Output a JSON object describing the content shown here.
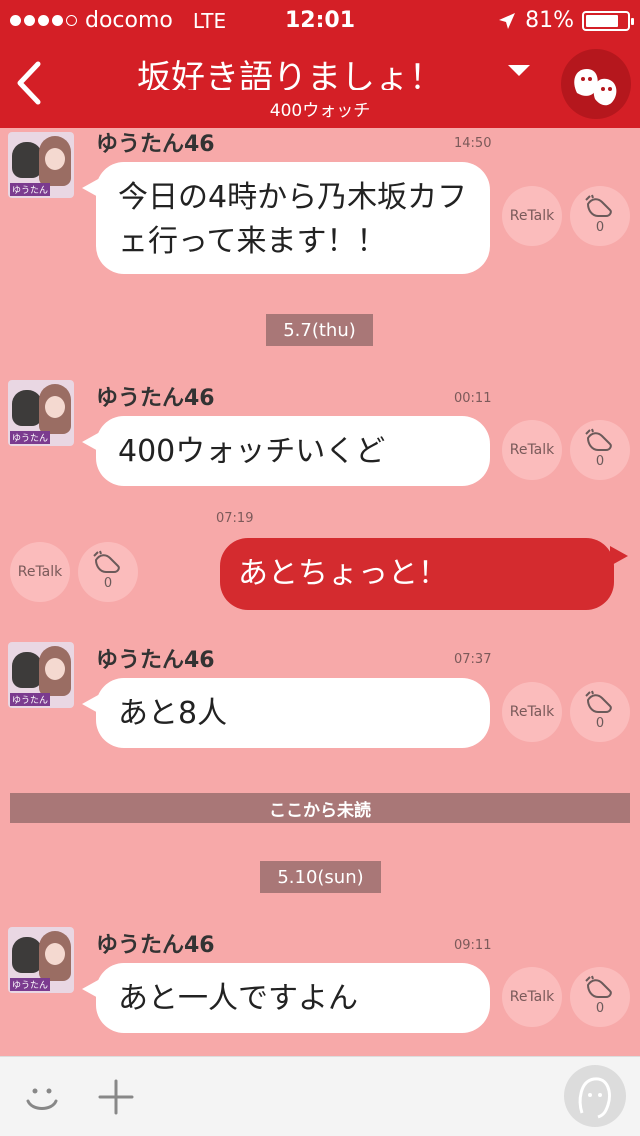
{
  "status_bar": {
    "carrier": "docomo",
    "network": "LTE",
    "time": "12:01",
    "battery": "81%",
    "battery_level": 0.81
  },
  "header": {
    "title": "坂好き語りましょ！",
    "subtitle": "400ウォッチ"
  },
  "messages": [
    {
      "sender": "ゆうたん46",
      "time": "14:50",
      "text": "今日の4時から乃木坂カフェ行って来ます！！",
      "retalk": "ReTalk",
      "claps": "0"
    },
    {
      "date_label": "5.7(thu)"
    },
    {
      "sender": "ゆうたん46",
      "time": "00:11",
      "text": "400ウォッチいくど",
      "retalk": "ReTalk",
      "claps": "0"
    },
    {
      "mine": true,
      "time": "07:19",
      "text": "あとちょっと！",
      "retalk": "ReTalk",
      "claps": "0"
    },
    {
      "sender": "ゆうたん46",
      "time": "07:37",
      "text": "あと8人",
      "retalk": "ReTalk",
      "claps": "0"
    },
    {
      "unread_label": "ここから未読"
    },
    {
      "date_label": "5.10(sun)"
    },
    {
      "sender": "ゆうたん46",
      "time": "09:11",
      "text": "あと一人ですよん",
      "retalk": "ReTalk",
      "claps": "0"
    }
  ],
  "avatar_caption": "ゆうたん",
  "icons": {
    "back": "chevron-left-icon",
    "menu": "caret-down-icon",
    "character": "ghost-icon",
    "clap": "clap-icon",
    "emoji": "smiley-icon",
    "add": "plus-icon",
    "voice": "face-icon"
  },
  "colors": {
    "header": "#d41f26",
    "background": "#f7a9a9",
    "my_bubble": "#d42b2f",
    "date_pill": "#a97777"
  }
}
